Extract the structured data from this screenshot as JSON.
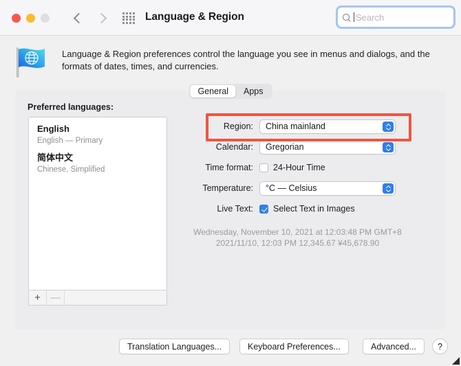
{
  "titlebar": {
    "title": "Language & Region",
    "traffic_lights": [
      "close",
      "minimize",
      "zoom"
    ],
    "search": {
      "placeholder": "Search",
      "value": ""
    }
  },
  "description": "Language & Region preferences control the language you see in menus and dialogs, and the formats of dates, times, and currencies.",
  "tabs": [
    {
      "label": "General",
      "active": true
    },
    {
      "label": "Apps",
      "active": false
    }
  ],
  "preferred_languages": {
    "label": "Preferred languages:",
    "items": [
      {
        "name": "English",
        "sub": "English — Primary"
      },
      {
        "name": "简体中文",
        "sub": "Chinese, Simplified"
      }
    ],
    "toolbar": {
      "add_label": "+",
      "remove_label": "—"
    }
  },
  "settings": {
    "region": {
      "label": "Region:",
      "value": "China mainland",
      "highlighted": true
    },
    "calendar": {
      "label": "Calendar:",
      "value": "Gregorian"
    },
    "time_format": {
      "label": "Time format:",
      "option_label": "24-Hour Time",
      "checked": false
    },
    "temperature": {
      "label": "Temperature:",
      "value": "°C — Celsius"
    },
    "live_text": {
      "label": "Live Text:",
      "option_label": "Select Text in Images",
      "checked": true
    }
  },
  "sample": {
    "line1": "Wednesday, November 10, 2021 at 12:03:48 PM GMT+8",
    "line2": "2021/11/10, 12:03 PM    12,345.67    ¥45,678.90"
  },
  "bottom_buttons": {
    "translation": "Translation Languages...",
    "keyboard": "Keyboard Preferences...",
    "advanced": "Advanced...",
    "help": "?"
  },
  "colors": {
    "accent_blue": "#2f7fec",
    "highlight_red": "#f05541",
    "close_red": "#f9564f",
    "minimize_yellow": "#f9bc2c",
    "zoom_gray": "#dedede",
    "window_bg": "#f0f0f0",
    "panel_bg": "#ececee"
  }
}
